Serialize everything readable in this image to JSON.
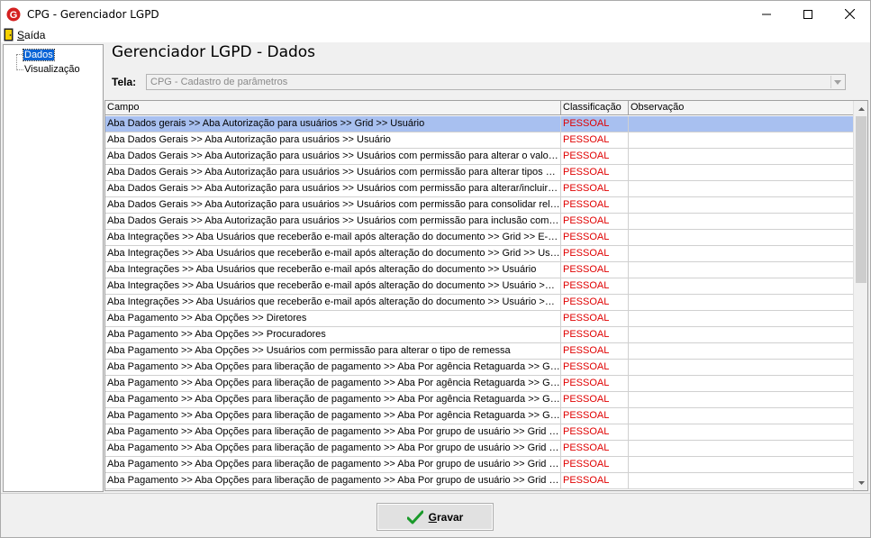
{
  "window": {
    "title": "CPG - Gerenciador LGPD"
  },
  "menu": {
    "saida_first": "S",
    "saida_rest": "aída"
  },
  "tree": {
    "items": [
      {
        "label": "Dados",
        "selected": true
      },
      {
        "label": "Visualização",
        "selected": false
      }
    ]
  },
  "page": {
    "heading": "Gerenciador LGPD - Dados"
  },
  "tela": {
    "label": "Tela:",
    "value": "CPG - Cadastro de parâmetros"
  },
  "grid": {
    "headers": {
      "campo": "Campo",
      "classificacao": "Classificação",
      "observacao": "Observação"
    },
    "rows": [
      {
        "campo": "Aba Dados gerais >> Aba Autorização para usuários >> Grid >> Usuário",
        "classificacao": "PESSOAL",
        "observacao": ""
      },
      {
        "campo": "Aba Dados Gerais >> Aba Autorização para usuários >> Usuário",
        "classificacao": "PESSOAL",
        "observacao": ""
      },
      {
        "campo": "Aba Dados Gerais >> Aba Autorização para usuários >> Usuários com permissão para alterar o valor de I...",
        "classificacao": "PESSOAL",
        "observacao": ""
      },
      {
        "campo": "Aba Dados Gerais >> Aba Autorização para usuários >> Usuários com permissão para alterar tipos de de...",
        "classificacao": "PESSOAL",
        "observacao": ""
      },
      {
        "campo": "Aba Dados Gerais >> Aba Autorização para usuários >> Usuários com permissão para alterar/incluir valor...",
        "classificacao": "PESSOAL",
        "observacao": ""
      },
      {
        "campo": "Aba Dados Gerais >> Aba Autorização para usuários >> Usuários com permissão para consolidar relatóri...",
        "classificacao": "PESSOAL",
        "observacao": ""
      },
      {
        "campo": "Aba Dados Gerais >> Aba Autorização para usuários >> Usuários com permissão para inclusão com data...",
        "classificacao": "PESSOAL",
        "observacao": ""
      },
      {
        "campo": "Aba Integrações  >> Aba Usuários que receberão e-mail após alteração do documento >> Grid >> E-mail",
        "classificacao": "PESSOAL",
        "observacao": ""
      },
      {
        "campo": "Aba Integrações  >> Aba Usuários que receberão e-mail após alteração do documento >> Grid >> Usuário",
        "classificacao": "PESSOAL",
        "observacao": ""
      },
      {
        "campo": "Aba Integrações >> Aba Usuários que receberão e-mail após alteração do documento >> Usuário",
        "classificacao": "PESSOAL",
        "observacao": ""
      },
      {
        "campo": "Aba Integrações >> Aba Usuários que receberão e-mail após alteração do documento >> Usuário >> Bro...",
        "classificacao": "PESSOAL",
        "observacao": ""
      },
      {
        "campo": "Aba Integrações >> Aba Usuários que receberão e-mail após alteração do documento >> Usuário >> Bro...",
        "classificacao": "PESSOAL",
        "observacao": ""
      },
      {
        "campo": "Aba Pagamento >> Aba Opções >> Diretores",
        "classificacao": "PESSOAL",
        "observacao": ""
      },
      {
        "campo": "Aba Pagamento >> Aba Opções >> Procuradores",
        "classificacao": "PESSOAL",
        "observacao": ""
      },
      {
        "campo": "Aba Pagamento >> Aba Opções >> Usuários com permissão para alterar o tipo de remessa",
        "classificacao": "PESSOAL",
        "observacao": ""
      },
      {
        "campo": "Aba Pagamento >> Aba Opções para liberação de pagamento >> Aba Por agência Retaguarda >> Grid ...",
        "classificacao": "PESSOAL",
        "observacao": ""
      },
      {
        "campo": "Aba Pagamento >> Aba Opções para liberação de pagamento >> Aba Por agência Retaguarda >> Grid ...",
        "classificacao": "PESSOAL",
        "observacao": ""
      },
      {
        "campo": "Aba Pagamento >> Aba Opções para liberação de pagamento >> Aba Por agência Retaguarda >> Grid ...",
        "classificacao": "PESSOAL",
        "observacao": ""
      },
      {
        "campo": "Aba Pagamento >> Aba Opções para liberação de pagamento >> Aba Por agência Retaguarda >> Grid ...",
        "classificacao": "PESSOAL",
        "observacao": ""
      },
      {
        "campo": "Aba Pagamento >> Aba Opções para liberação de pagamento >> Aba Por grupo de usuário >> Grid Seto...",
        "classificacao": "PESSOAL",
        "observacao": ""
      },
      {
        "campo": "Aba Pagamento >> Aba Opções para liberação de pagamento >> Aba Por grupo de usuário >> Grid Seto...",
        "classificacao": "PESSOAL",
        "observacao": ""
      },
      {
        "campo": "Aba Pagamento >> Aba Opções para liberação de pagamento >> Aba Por grupo de usuário >> Grid Usu...",
        "classificacao": "PESSOAL",
        "observacao": ""
      },
      {
        "campo": "Aba Pagamento >> Aba Opções para liberação de pagamento >> Aba Por grupo de usuário >> Grid Usu...",
        "classificacao": "PESSOAL",
        "observacao": ""
      }
    ]
  },
  "buttons": {
    "gravar_first": "G",
    "gravar_rest": "ravar"
  },
  "colors": {
    "selected_row": "#a8c0f0",
    "classification_text": "#e00000",
    "tree_selected": "#0a64d6"
  }
}
